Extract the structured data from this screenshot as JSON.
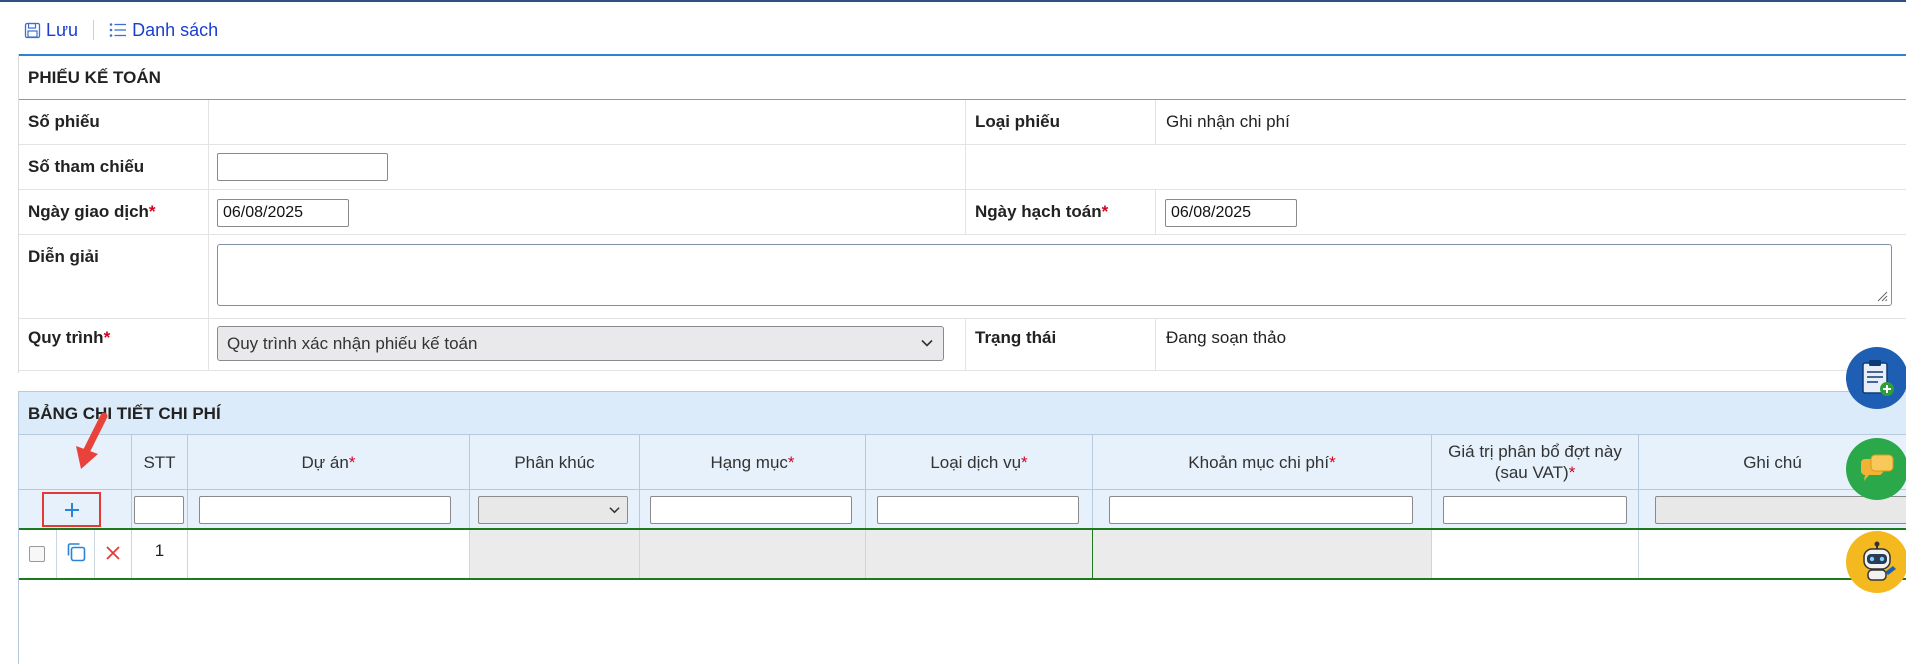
{
  "toolbar": {
    "save_label": "Lưu",
    "list_label": "Danh sách"
  },
  "section1": {
    "title": "PHIẾU KẾ TOÁN",
    "so_phieu_label": "Số phiếu",
    "loai_phieu_label": "Loại phiếu",
    "loai_phieu_value": "Ghi nhận chi phí",
    "so_tham_chieu_label": "Số tham chiếu",
    "so_tham_chieu_value": "",
    "ngay_giao_dich_label": "Ngày giao dịch",
    "ngay_giao_dich_value": "06/08/2025",
    "ngay_hach_toan_label": "Ngày hạch toán",
    "ngay_hach_toan_value": "06/08/2025",
    "dien_giai_label": "Diễn giải",
    "quy_trinh_label": "Quy trình",
    "quy_trinh_value": "Quy trình xác nhận phiếu kế toán",
    "trang_thai_label": "Trạng thái",
    "trang_thai_value": "Đang soạn thảo",
    "required_mark": "*"
  },
  "section2": {
    "title": "BẢNG CHI TIẾT CHI PHÍ",
    "columns": {
      "stt": "STT",
      "du_an": "Dự án",
      "phan_khuc": "Phân khúc",
      "hang_muc": "Hạng mục",
      "loai_dich_vu": "Loại dịch vụ",
      "khoan_muc": "Khoản mục chi phí",
      "gia_tri_line1": "Giá trị phân bổ đợt này",
      "gia_tri_line2": "(sau VAT)",
      "ghi_chu": "Ghi chú"
    },
    "rows": [
      {
        "stt": "1"
      }
    ]
  },
  "colors": {
    "accent_blue": "#2a83d6",
    "link_blue": "#1a3fd0",
    "required_red": "#d0021b",
    "row_green": "#1e7a1e",
    "header_bg": "#dcebf9"
  },
  "icons": {
    "save": "save-icon",
    "list": "list-icon",
    "add": "plus-icon",
    "copy": "copy-icon",
    "delete": "close-icon",
    "fab1": "clipboard-add-icon",
    "fab2": "chat-icon",
    "fab3": "robot-support-icon"
  }
}
